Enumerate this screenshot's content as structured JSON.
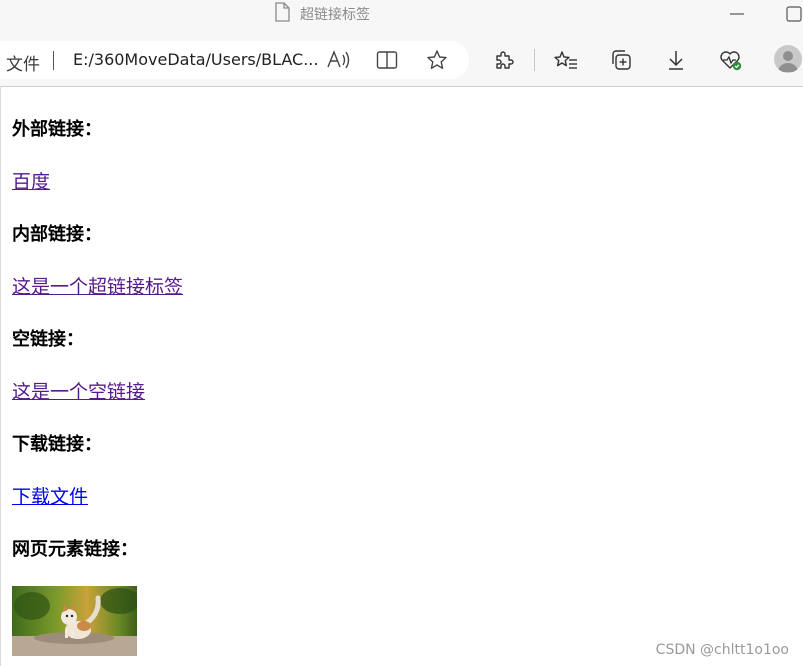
{
  "window": {
    "title": "超链接标签"
  },
  "toolbar": {
    "file_label": "文件",
    "url": "E:/360MoveData/Users/BLAC...",
    "icons": [
      "read-aloud-icon",
      "split-screen-icon",
      "favorite-star-icon",
      "extensions-icon",
      "favorites-list-icon",
      "collections-icon",
      "download-icon",
      "browser-essentials-icon",
      "profile-avatar-icon"
    ]
  },
  "page": {
    "sections": [
      {
        "heading": "外部链接：",
        "link_text": "百度",
        "link_state": "visited"
      },
      {
        "heading": "内部链接：",
        "link_text": "这是一个超链接标签",
        "link_state": "visited"
      },
      {
        "heading": "空链接：",
        "link_text": "这是一个空链接",
        "link_state": "visited"
      },
      {
        "heading": "下载链接：",
        "link_text": "下载文件",
        "link_state": "unvisited"
      },
      {
        "heading": "网页元素链接："
      }
    ]
  },
  "watermark": "CSDN @chltt1o1oo",
  "colors": {
    "visited_link": "#551a8b",
    "unvisited_link": "#0000ee",
    "chrome_background": "#f7f7f7"
  }
}
